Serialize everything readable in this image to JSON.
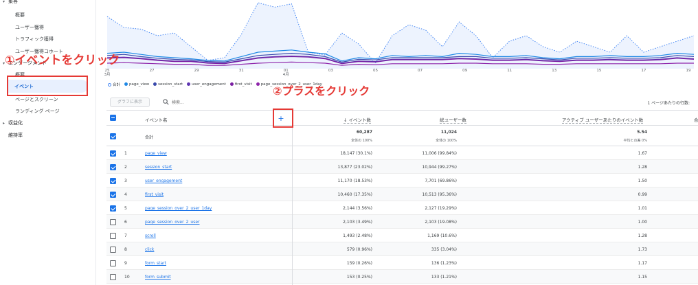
{
  "sidebar": {
    "section_acquisition": "集客",
    "items_acquisition": [
      "概要",
      "ユーザー獲得",
      "トラフィック獲得",
      "ユーザー獲得コホート"
    ],
    "section_engagement": "エンゲージメント",
    "items_engagement": [
      "概要",
      "イベント",
      "ページとスクリーン",
      "ランディング ページ"
    ],
    "section_monetization": "収益化",
    "section_retention": "維持率"
  },
  "annotations": {
    "step1": "①イベントをクリック",
    "step2": "②プラスをクリック"
  },
  "chart_data": {
    "type": "line",
    "x_ticks": [
      "25\n3月",
      "27",
      "29",
      "31",
      "01\n4月",
      "03",
      "05",
      "07",
      "09",
      "11",
      "13",
      "15",
      "17",
      "19"
    ],
    "series": [
      {
        "name": "合計",
        "values": [
          95,
          75,
          72,
          60,
          65,
          40,
          15,
          20,
          62,
          120,
          112,
          118,
          30,
          25,
          65,
          45,
          10,
          60,
          80,
          70,
          40,
          85,
          60,
          20,
          50,
          60,
          40,
          30,
          50,
          40,
          30,
          60,
          30,
          40,
          50,
          60
        ]
      },
      {
        "name": "page_view",
        "values": [
          28,
          30,
          26,
          22,
          20,
          18,
          15,
          14,
          22,
          30,
          32,
          34,
          30,
          27,
          14,
          20,
          18,
          24,
          22,
          24,
          22,
          28,
          26,
          22,
          22,
          24,
          20,
          18,
          22,
          22,
          24,
          22,
          22,
          24,
          28,
          26
        ]
      },
      {
        "name": "session_start",
        "values": [
          24,
          26,
          22,
          19,
          17,
          16,
          13,
          12,
          18,
          24,
          26,
          28,
          26,
          22,
          12,
          17,
          16,
          20,
          20,
          20,
          20,
          22,
          22,
          19,
          19,
          20,
          18,
          16,
          19,
          19,
          20,
          19,
          19,
          20,
          24,
          22
        ]
      },
      {
        "name": "user_engagement",
        "values": [
          20,
          21,
          19,
          16,
          14,
          14,
          11,
          10,
          15,
          20,
          22,
          23,
          22,
          19,
          10,
          14,
          13,
          17,
          17,
          17,
          17,
          19,
          18,
          16,
          16,
          17,
          15,
          14,
          16,
          16,
          17,
          16,
          16,
          17,
          20,
          18
        ]
      },
      {
        "name": "first_visit",
        "values": [
          19,
          20,
          18,
          15,
          13,
          13,
          10,
          9,
          14,
          19,
          21,
          22,
          21,
          18,
          9,
          13,
          12,
          16,
          16,
          16,
          16,
          18,
          17,
          15,
          15,
          16,
          14,
          13,
          15,
          15,
          16,
          15,
          15,
          16,
          19,
          17
        ]
      },
      {
        "name": "page_session_over_2_user_1day",
        "values": [
          10,
          11,
          10,
          9,
          8,
          8,
          6,
          6,
          8,
          10,
          11,
          12,
          11,
          10,
          6,
          8,
          7,
          9,
          9,
          9,
          9,
          10,
          10,
          9,
          9,
          9,
          8,
          8,
          9,
          9,
          9,
          9,
          9,
          9,
          10,
          10
        ]
      }
    ],
    "colors": [
      "#4285f4",
      "#1e88e5",
      "#3949ab",
      "#5e35b1",
      "#7b1fa2",
      "#8e24aa"
    ]
  },
  "legend": [
    "合計",
    "page_view",
    "session_start",
    "user_engagement",
    "first_visit",
    "page_session_over_2_user_1day"
  ],
  "toolbar": {
    "graph_button": "グラフに表示",
    "search_placeholder": "検索...",
    "rows_per_page": "1 ページあたりの行数:"
  },
  "table": {
    "headers": {
      "event_name": "イベント名",
      "event_count": "↓ イベント数",
      "total_users": "総ユーザー数",
      "events_per_user": "アクティブ ユーザーあたりのイベント数",
      "extra": "合"
    },
    "total": {
      "label": "合計",
      "event_count": "60,287",
      "event_count_sub": "全体の 100%",
      "total_users": "11,024",
      "total_users_sub": "全体の 100%",
      "events_per_user": "5.54",
      "events_per_user_sub": "平均との差 0%"
    },
    "rows": [
      {
        "idx": "1",
        "name": "page_view",
        "events": "18,147 (30.1%)",
        "users": "11,006 (99.84%)",
        "per_user": "1.67",
        "checked": true
      },
      {
        "idx": "2",
        "name": "session_start",
        "events": "13,877 (23.02%)",
        "users": "10,944 (99.27%)",
        "per_user": "1.28",
        "checked": true
      },
      {
        "idx": "3",
        "name": "user_engagement",
        "events": "11,170 (18.53%)",
        "users": "7,701 (69.86%)",
        "per_user": "1.50",
        "checked": true
      },
      {
        "idx": "4",
        "name": "first_visit",
        "events": "10,460 (17.35%)",
        "users": "10,513 (95.36%)",
        "per_user": "0.99",
        "checked": true
      },
      {
        "idx": "5",
        "name": "page_session_over_2_user_1day",
        "events": "2,144 (3.56%)",
        "users": "2,127 (19.29%)",
        "per_user": "1.01",
        "checked": true
      },
      {
        "idx": "6",
        "name": "page_session_over_2_user",
        "events": "2,103 (3.49%)",
        "users": "2,103 (19.08%)",
        "per_user": "1.00",
        "checked": false
      },
      {
        "idx": "7",
        "name": "scroll",
        "events": "1,493 (2.48%)",
        "users": "1,169 (10.6%)",
        "per_user": "1.28",
        "checked": false
      },
      {
        "idx": "8",
        "name": "click",
        "events": "579 (0.96%)",
        "users": "335 (3.04%)",
        "per_user": "1.73",
        "checked": false
      },
      {
        "idx": "9",
        "name": "form_start",
        "events": "159 (0.26%)",
        "users": "136 (1.23%)",
        "per_user": "1.17",
        "checked": false
      },
      {
        "idx": "10",
        "name": "form_submit",
        "events": "153 (0.25%)",
        "users": "133 (1.21%)",
        "per_user": "1.15",
        "checked": false
      }
    ]
  }
}
